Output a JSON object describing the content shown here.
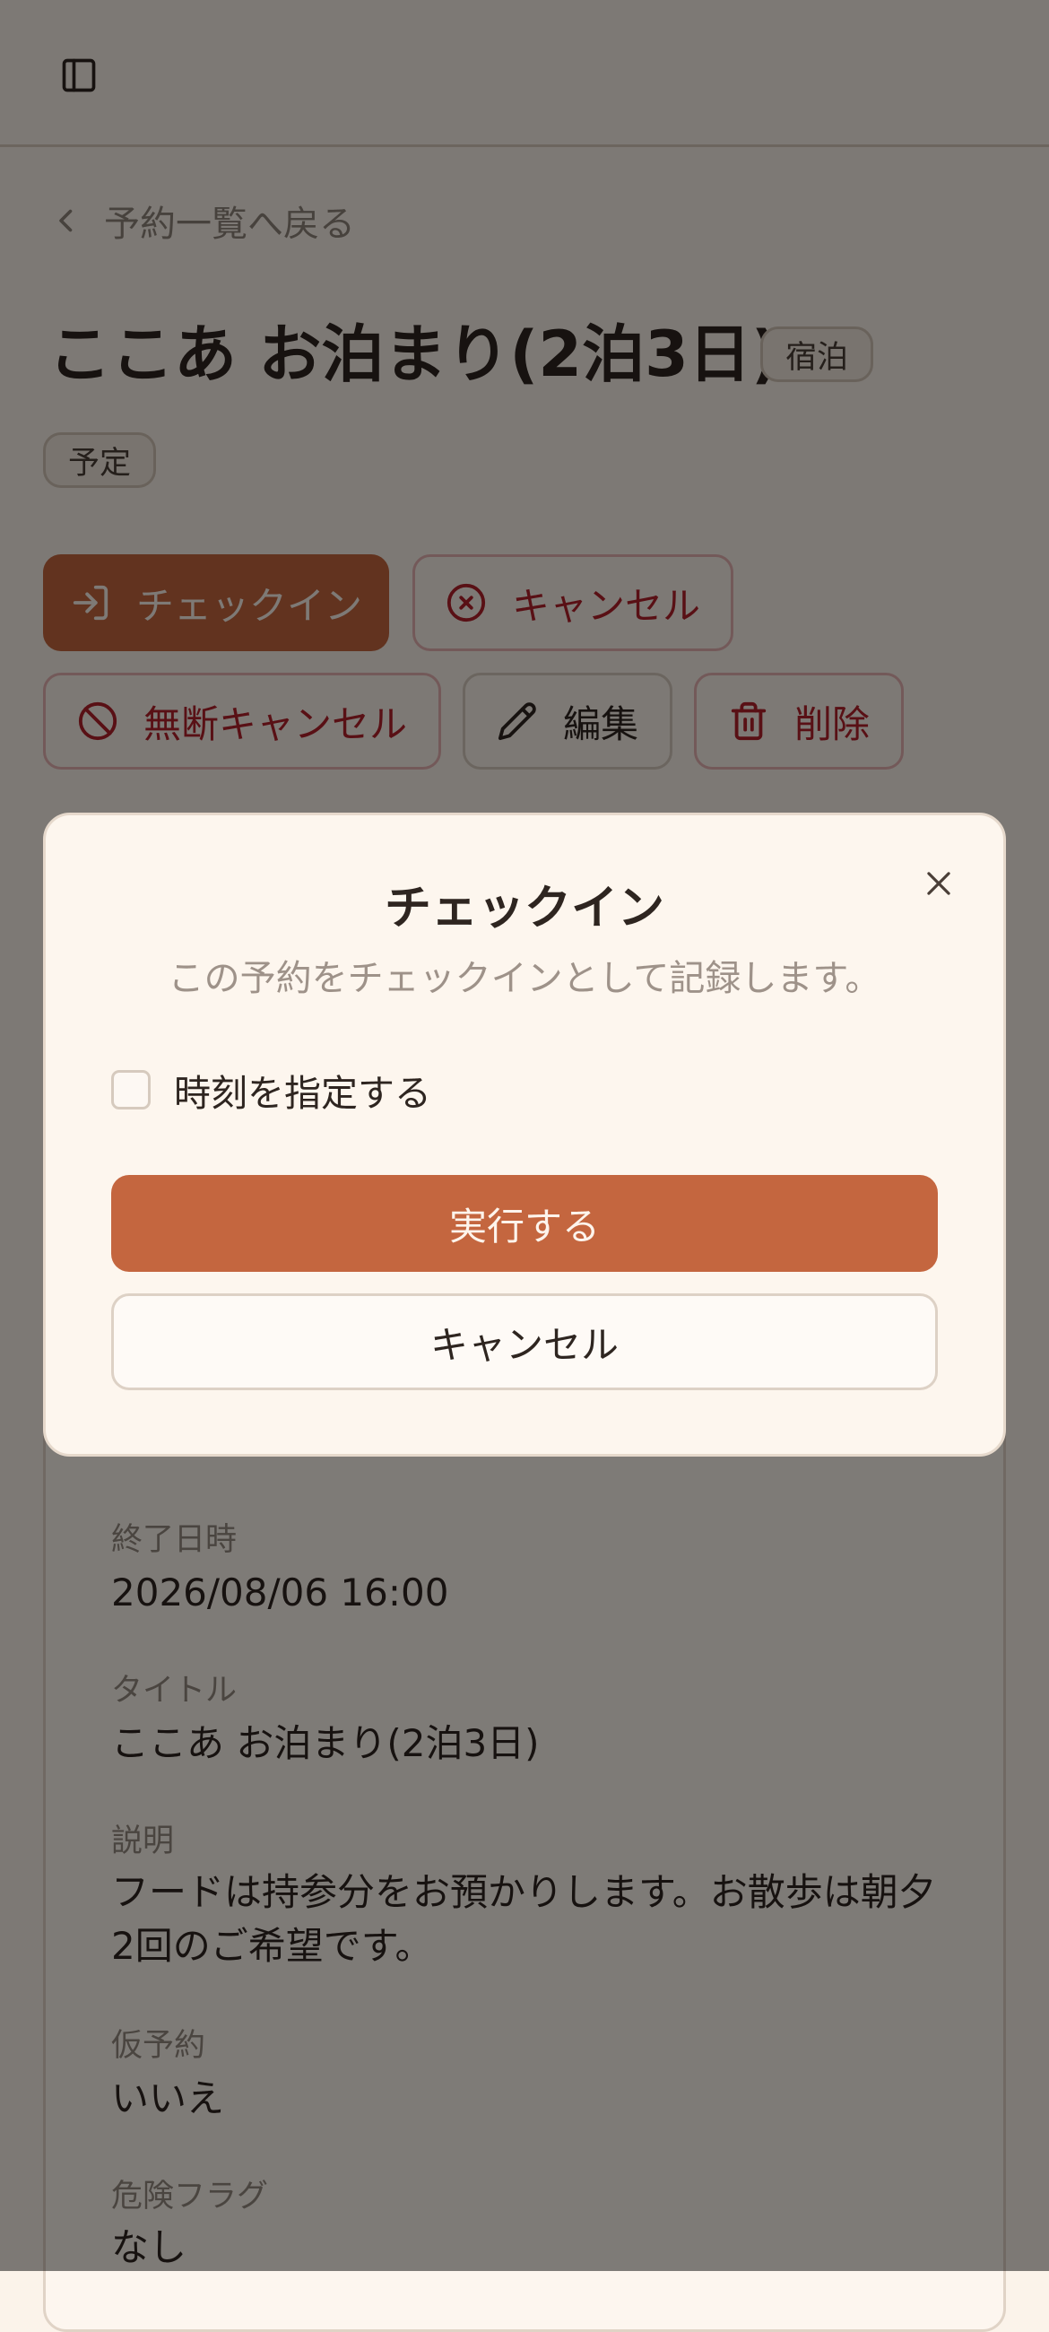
{
  "header": {
    "sidebar_toggle_icon": "sidebar-panel-icon"
  },
  "back_link": {
    "label": "予約一覧へ戻る",
    "icon": "chevron-left-icon"
  },
  "reservation": {
    "title": "ここあ お泊まり(2泊3日)",
    "type_badge": "宿泊",
    "status_badge": "予定"
  },
  "actions": {
    "checkin": "チェックイン",
    "cancel": "キャンセル",
    "no_show_cancel": "無断キャンセル",
    "edit": "編集",
    "delete": "削除"
  },
  "details": {
    "end_label": "終了日時",
    "end_value": "2026/08/06 16:00",
    "title_label": "タイトル",
    "title_value": "ここあ お泊まり(2泊3日)",
    "description_label": "説明",
    "description_value": "フードは持参分をお預かりします。お散歩は朝夕2回のご希望です。",
    "provisional_label": "仮予約",
    "provisional_value": "いいえ",
    "danger_label": "危険フラグ",
    "danger_value": "なし"
  },
  "modal": {
    "title": "チェックイン",
    "description": "この予約をチェックインとして記録します。",
    "checkbox_label": "時刻を指定する",
    "checkbox_checked": false,
    "confirm_label": "実行する",
    "cancel_label": "キャンセル",
    "close_icon": "close-icon"
  },
  "colors": {
    "background": "#fbf3ea",
    "primary": "#c4663f",
    "danger": "#b2202a",
    "overlay": "rgba(0,0,0,0.5)"
  }
}
